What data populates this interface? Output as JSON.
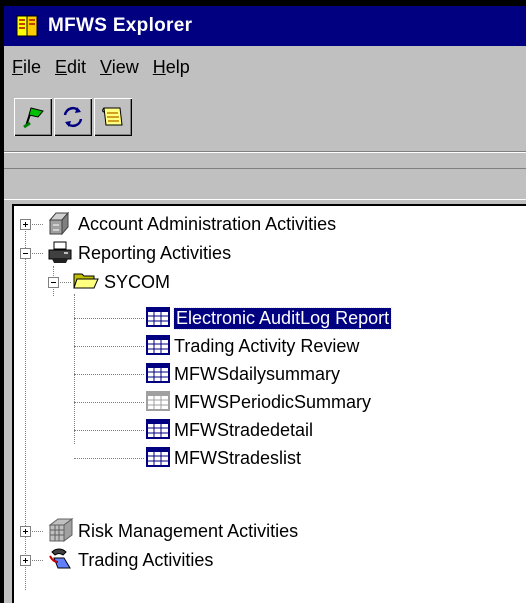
{
  "window": {
    "title": "MFWS Explorer"
  },
  "menu": [
    {
      "underline": "F",
      "rest": "ile"
    },
    {
      "underline": "E",
      "rest": "dit"
    },
    {
      "underline": "V",
      "rest": "iew"
    },
    {
      "underline": "H",
      "rest": "elp"
    }
  ],
  "toolbar": {
    "buttons": [
      "go-icon",
      "refresh-icon",
      "scroll-icon"
    ]
  },
  "tree": {
    "account_admin": "Account Administration Activities",
    "reporting": "Reporting Activities",
    "sycom": "SYCOM",
    "reports": [
      "Electronic AuditLog Report",
      "Trading Activity Review",
      "MFWSdailysummary",
      "MFWSPeriodicSummary",
      "MFWStradedetail",
      "MFWStradeslist"
    ],
    "risk": "Risk Management Activities",
    "trading": "Trading Activities"
  },
  "colors": {
    "titlebar": "#000080",
    "selection": "#000080",
    "face": "#c0c0c0"
  }
}
